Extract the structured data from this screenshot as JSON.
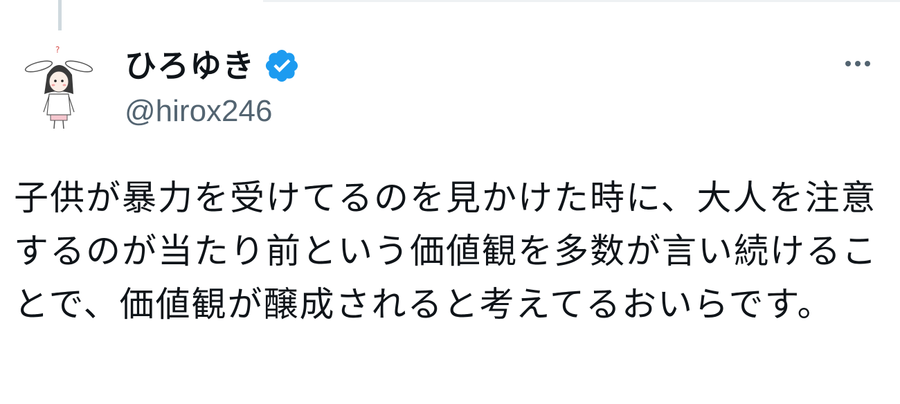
{
  "tweet": {
    "author": {
      "display_name": "ひろゆき",
      "handle": "@hirox246",
      "verified": true,
      "avatar_icon": "rabbit-ear-character-avatar"
    },
    "text": "子供が暴力を受けてるのを見かけた時に、大人を注意するのが当たり前という価値観を多数が言い続けることで、価値観が醸成されると考えてるおいらです。",
    "more_icon": "more-dots-icon",
    "verified_icon": "verified-badge-icon"
  },
  "colors": {
    "text_primary": "#0f1419",
    "text_secondary": "#536471",
    "verified_blue": "#1d9bf0",
    "thread_line": "#cfd9de"
  }
}
